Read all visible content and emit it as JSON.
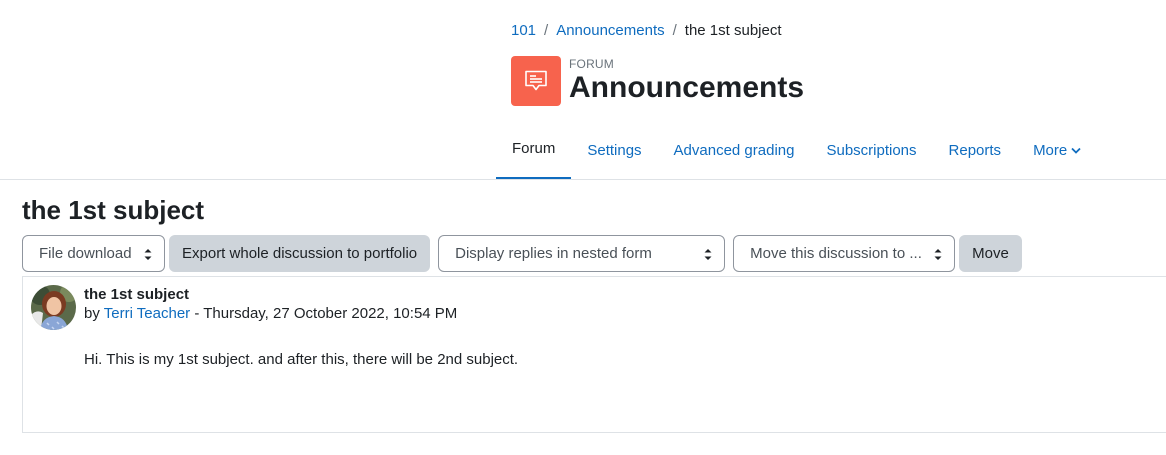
{
  "breadcrumb": {
    "items": [
      {
        "label": "101"
      },
      {
        "label": "Announcements"
      }
    ],
    "separator": "/",
    "current": "the 1st subject"
  },
  "header": {
    "module_label": "FORUM",
    "title": "Announcements",
    "icon": "forum-chat-icon",
    "icon_color": "#f7634d"
  },
  "tabs": [
    {
      "label": "Forum",
      "active": true
    },
    {
      "label": "Settings"
    },
    {
      "label": "Advanced grading"
    },
    {
      "label": "Subscriptions"
    },
    {
      "label": "Reports"
    },
    {
      "label": "More",
      "icon": "chevron-down-icon"
    }
  ],
  "discussion": {
    "title": "the 1st subject",
    "controls": {
      "file_download": "File download",
      "export_button": "Export whole discussion to portfolio",
      "display_mode": "Display replies in nested form",
      "move_select": "Move this discussion to ...",
      "move_button": "Move"
    }
  },
  "post": {
    "subject": "the 1st subject",
    "by_prefix": "by",
    "author": "Terri Teacher",
    "date_separator": "-",
    "date": "Thursday, 27 October 2022, 10:54 PM",
    "body": "Hi. This is my 1st subject. and after this, there will be 2nd subject."
  },
  "colors": {
    "link": "#0f6cbf",
    "accent": "#0f6cbf",
    "button_bg": "#ced4da"
  }
}
